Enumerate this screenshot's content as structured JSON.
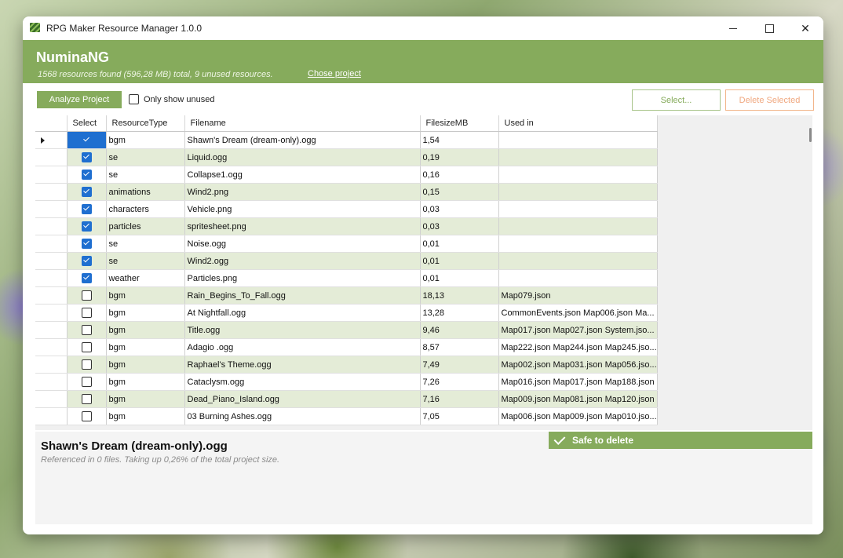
{
  "window": {
    "title": "RPG Maker Resource Manager 1.0.0"
  },
  "header": {
    "project_name": "NuminaNG",
    "summary": "1568 resources found (596,28 MB) total, 9 unused resources.",
    "chose_project": "Chose project"
  },
  "toolbar": {
    "analyze": "Analyze Project",
    "only_unused": "Only show unused",
    "select": "Select...",
    "delete_selected": "Delete Selected"
  },
  "table": {
    "columns": [
      "Select",
      "ResourceType",
      "Filename",
      "FilesizeMB",
      "Used in"
    ],
    "rows": [
      {
        "checked": true,
        "type": "bgm",
        "file": "Shawn's Dream (dream-only).ogg",
        "size": "1,54",
        "used": ""
      },
      {
        "checked": true,
        "type": "se",
        "file": "Liquid.ogg",
        "size": "0,19",
        "used": ""
      },
      {
        "checked": true,
        "type": "se",
        "file": "Collapse1.ogg",
        "size": "0,16",
        "used": ""
      },
      {
        "checked": true,
        "type": "animations",
        "file": "Wind2.png",
        "size": "0,15",
        "used": ""
      },
      {
        "checked": true,
        "type": "characters",
        "file": "Vehicle.png",
        "size": "0,03",
        "used": ""
      },
      {
        "checked": true,
        "type": "particles",
        "file": "spritesheet.png",
        "size": "0,03",
        "used": ""
      },
      {
        "checked": true,
        "type": "se",
        "file": "Noise.ogg",
        "size": "0,01",
        "used": ""
      },
      {
        "checked": true,
        "type": "se",
        "file": "Wind2.ogg",
        "size": "0,01",
        "used": ""
      },
      {
        "checked": true,
        "type": "weather",
        "file": "Particles.png",
        "size": "0,01",
        "used": ""
      },
      {
        "checked": false,
        "type": "bgm",
        "file": "Rain_Begins_To_Fall.ogg",
        "size": "18,13",
        "used": "Map079.json"
      },
      {
        "checked": false,
        "type": "bgm",
        "file": "At Nightfall.ogg",
        "size": "13,28",
        "used": "CommonEvents.json Map006.json Ma..."
      },
      {
        "checked": false,
        "type": "bgm",
        "file": "Title.ogg",
        "size": "9,46",
        "used": "Map017.json Map027.json System.jso..."
      },
      {
        "checked": false,
        "type": "bgm",
        "file": "Adagio .ogg",
        "size": "8,57",
        "used": "Map222.json Map244.json Map245.jso..."
      },
      {
        "checked": false,
        "type": "bgm",
        "file": "Raphael's Theme.ogg",
        "size": "7,49",
        "used": "Map002.json Map031.json Map056.jso..."
      },
      {
        "checked": false,
        "type": "bgm",
        "file": "Cataclysm.ogg",
        "size": "7,26",
        "used": "Map016.json Map017.json Map188.json"
      },
      {
        "checked": false,
        "type": "bgm",
        "file": "Dead_Piano_Island.ogg",
        "size": "7,16",
        "used": "Map009.json Map081.json Map120.json"
      },
      {
        "checked": false,
        "type": "bgm",
        "file": "03 Burning Ashes.ogg",
        "size": "7,05",
        "used": "Map006.json Map009.json Map010.jso..."
      }
    ]
  },
  "detail": {
    "title": "Shawn's Dream (dream-only).ogg",
    "subtitle": "Referenced in 0 files. Taking up 0,26% of the total project size.",
    "status": "Safe to delete"
  }
}
